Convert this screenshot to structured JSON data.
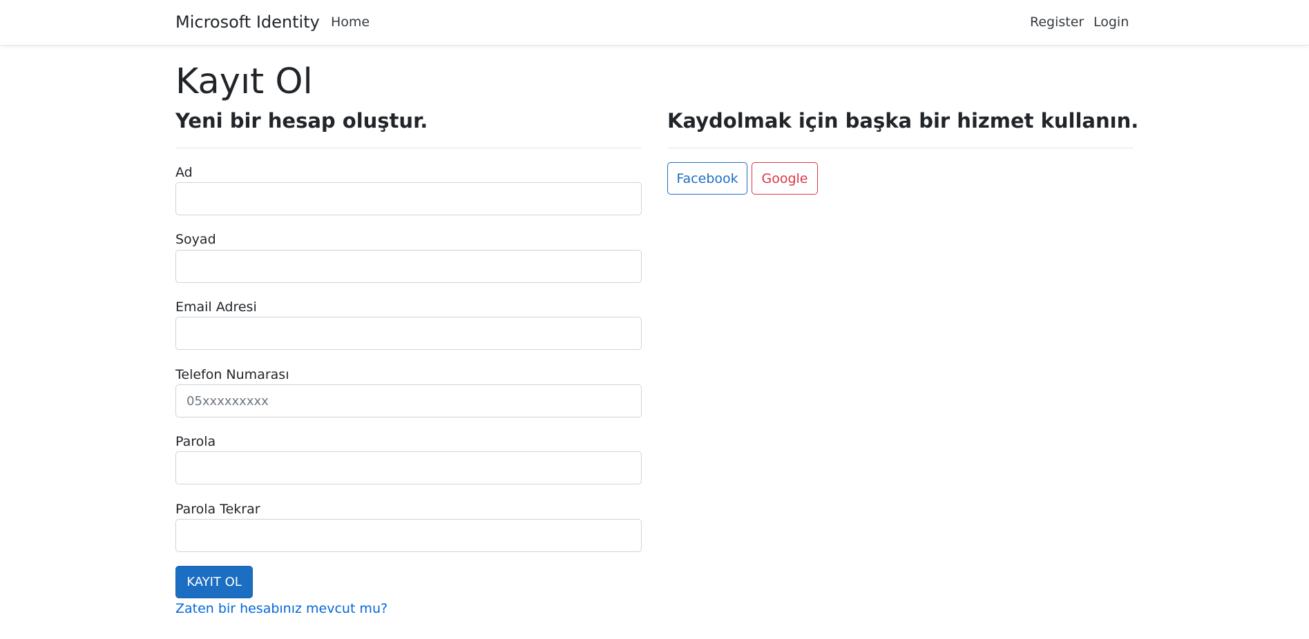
{
  "navbar": {
    "brand": "Microsoft Identity",
    "home": "Home",
    "register": "Register",
    "login": "Login"
  },
  "page": {
    "title": "Kayıt Ol",
    "left_heading": "Yeni bir hesap oluştur.",
    "right_heading": "Kaydolmak için başka bir hizmet kullanın."
  },
  "form": {
    "fields": [
      {
        "label": "Ad",
        "value": "",
        "placeholder": ""
      },
      {
        "label": "Soyad",
        "value": "",
        "placeholder": ""
      },
      {
        "label": "Email Adresi",
        "value": "",
        "placeholder": ""
      },
      {
        "label": "Telefon Numarası",
        "value": "",
        "placeholder": "05xxxxxxxxx"
      },
      {
        "label": "Parola",
        "value": "",
        "placeholder": ""
      },
      {
        "label": "Parola Tekrar",
        "value": "",
        "placeholder": ""
      }
    ],
    "submit_label": "KAYIT OL",
    "login_link": "Zaten bir hesabınız mevcut mu?"
  },
  "external": {
    "facebook": "Facebook",
    "google": "Google"
  },
  "colors": {
    "primary": "#1b6ec2",
    "link": "#0366d6",
    "danger": "#dc3545"
  }
}
